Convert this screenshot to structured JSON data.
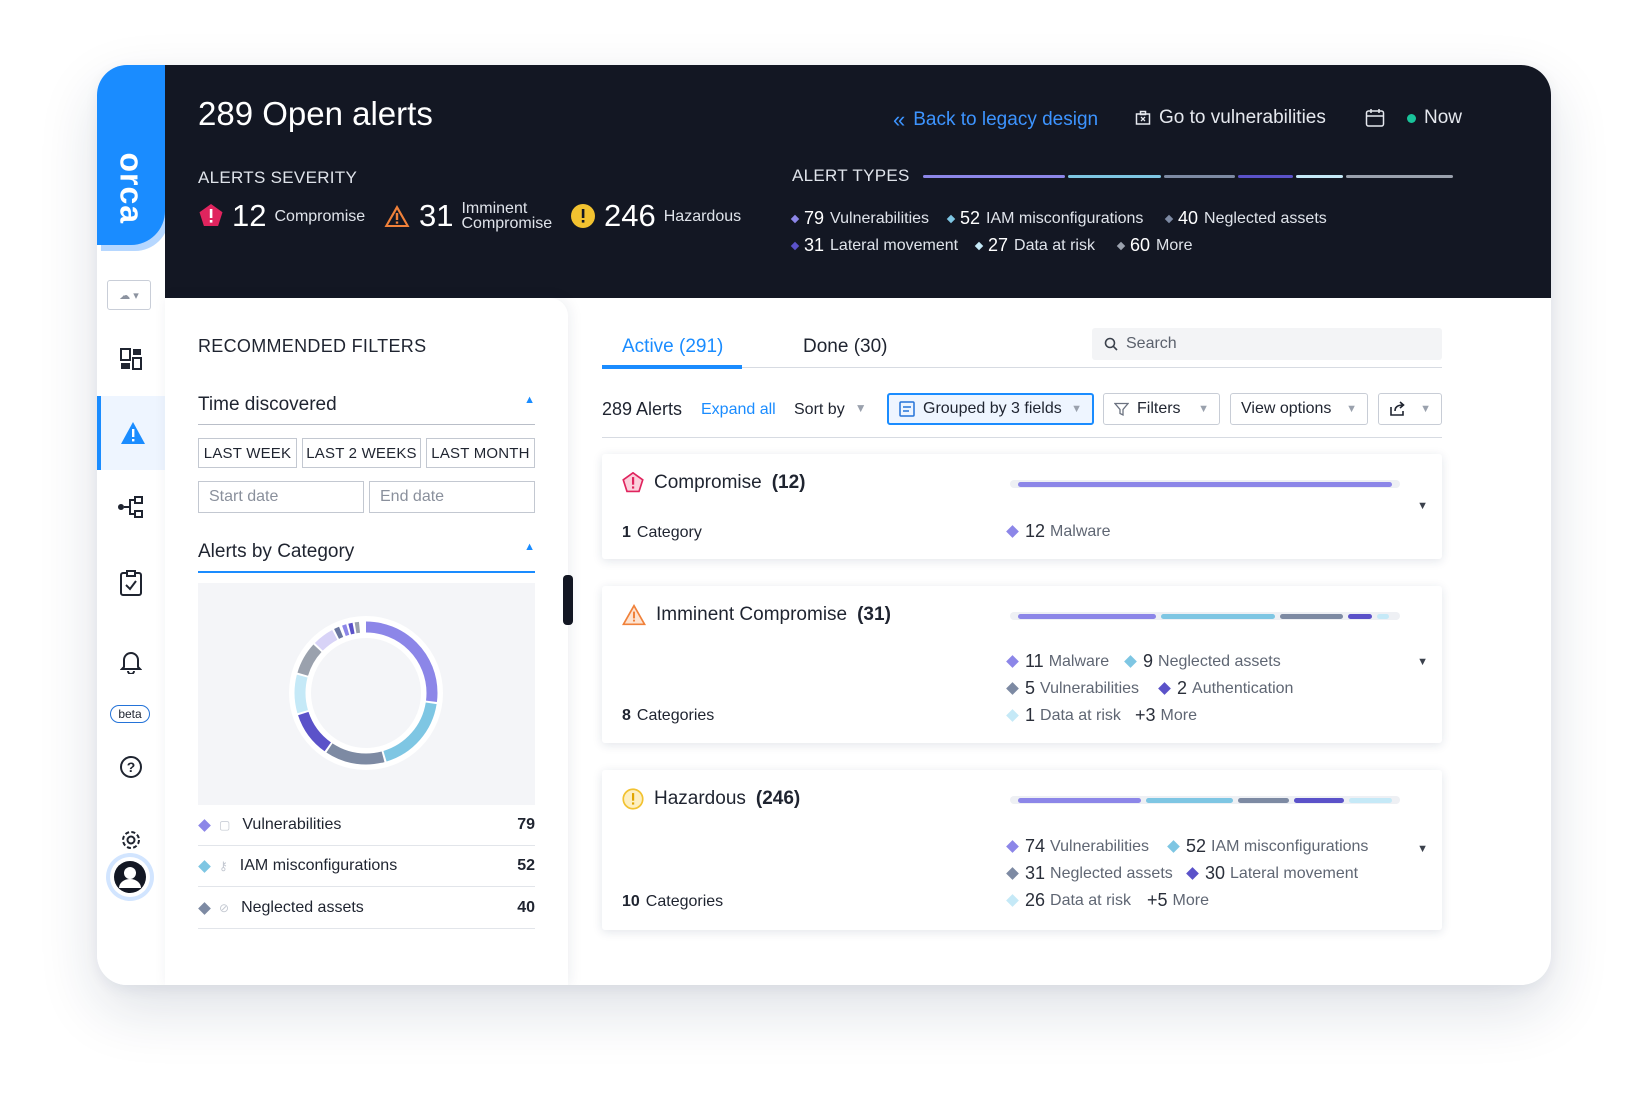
{
  "header": {
    "title": "289 Open alerts",
    "back_link": "Back to legacy design",
    "vuln_link": "Go to vulnerabilities",
    "time_label": "Now"
  },
  "severity": {
    "label": "ALERTS SEVERITY",
    "items": [
      {
        "count": "12",
        "label": "Compromise",
        "color": "#e0245e"
      },
      {
        "count": "31",
        "label_line1": "Imminent",
        "label_line2": "Compromise",
        "color": "#f0813a"
      },
      {
        "count": "246",
        "label": "Hazardous",
        "color": "#f2c230"
      }
    ]
  },
  "alert_types": {
    "label": "ALERT TYPES",
    "items": [
      {
        "count": "79",
        "label": "Vulnerabilities",
        "color": "#8c86e8"
      },
      {
        "count": "52",
        "label": "IAM misconfigurations",
        "color": "#7ec6e3"
      },
      {
        "count": "40",
        "label": "Neglected assets",
        "color": "#7d8aa3"
      },
      {
        "count": "31",
        "label": "Lateral movement",
        "color": "#5b52c9"
      },
      {
        "count": "27",
        "label": "Data at risk",
        "color": "#c5e9f7"
      },
      {
        "count": "60",
        "label": "More",
        "color": "#9aa1ad"
      }
    ]
  },
  "sidebar": {
    "beta": "beta"
  },
  "filters": {
    "title": "RECOMMENDED FILTERS",
    "time_section": "Time discovered",
    "chips": [
      "LAST WEEK",
      "LAST 2 WEEKS",
      "LAST MONTH"
    ],
    "start_placeholder": "Start date",
    "end_placeholder": "End date",
    "category_section": "Alerts by Category",
    "categories": [
      {
        "label": "Vulnerabilities",
        "count": "79"
      },
      {
        "label": "IAM misconfigurations",
        "count": "52"
      },
      {
        "label": "Neglected assets",
        "count": "40"
      }
    ]
  },
  "main": {
    "tab_active": "Active (291)",
    "tab_done": "Done (30)",
    "search_placeholder": "Search",
    "alerts_count": "289 Alerts",
    "expand_all": "Expand all",
    "sort_by": "Sort by",
    "grouped": "Grouped by 3 fields",
    "filters": "Filters",
    "view_options": "View options"
  },
  "cards": [
    {
      "title": "Compromise",
      "count": "(12)",
      "cats_num": "1",
      "cats_label": "Category",
      "stats": [
        {
          "num": "12",
          "label": "Malware",
          "color": "#8c86e8"
        }
      ]
    },
    {
      "title": "Imminent Compromise",
      "count": "(31)",
      "cats_num": "8",
      "cats_label": "Categories",
      "stats": [
        {
          "num": "11",
          "label": "Malware",
          "color": "#8c86e8"
        },
        {
          "num": "9",
          "label": "Neglected assets",
          "color": "#7ec6e3"
        },
        {
          "num": "5",
          "label": "Vulnerabilities",
          "color": "#7d8aa3"
        },
        {
          "num": "2",
          "label": "Authentication",
          "color": "#5b52c9"
        },
        {
          "num": "1",
          "label": "Data at risk",
          "color": "#c5e9f7"
        }
      ],
      "more_num": "+3",
      "more_label": "More"
    },
    {
      "title": "Hazardous",
      "count": "(246)",
      "cats_num": "10",
      "cats_label": "Categories",
      "stats": [
        {
          "num": "74",
          "label": "Vulnerabilities",
          "color": "#8c86e8"
        },
        {
          "num": "52",
          "label": "IAM misconfigurations",
          "color": "#7ec6e3"
        },
        {
          "num": "31",
          "label": "Neglected assets",
          "color": "#7d8aa3"
        },
        {
          "num": "30",
          "label": "Lateral movement",
          "color": "#5b52c9"
        },
        {
          "num": "26",
          "label": "Data at risk",
          "color": "#c5e9f7"
        }
      ],
      "more_num": "+5",
      "more_label": "More"
    }
  ],
  "colors": {
    "accent": "#1a8cff",
    "header_bg": "#131723"
  }
}
